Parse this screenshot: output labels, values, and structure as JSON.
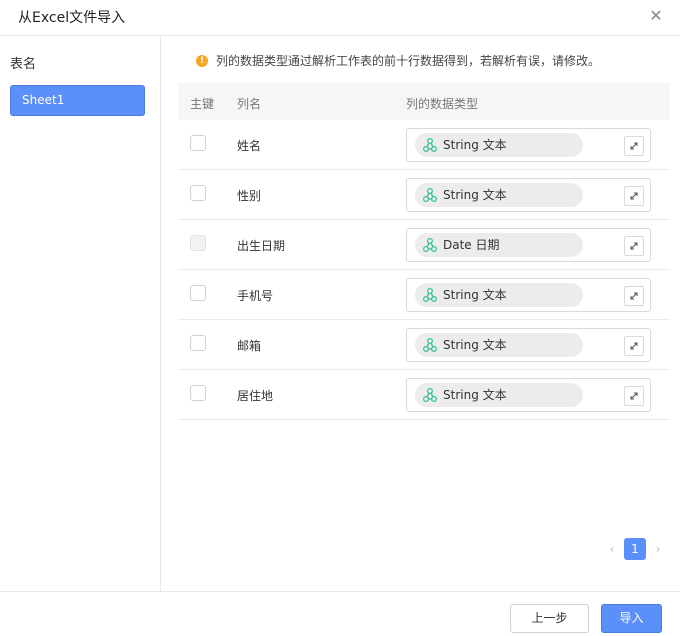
{
  "dialog": {
    "title": "从Excel文件导入",
    "close_icon": "close-icon"
  },
  "sidebar": {
    "label": "表名",
    "sheets": [
      {
        "label": "Sheet1",
        "selected": true
      }
    ]
  },
  "notice": {
    "icon": "warning-icon",
    "text": "列的数据类型通过解析工作表的前十行数据得到，若解析有误，请修改。"
  },
  "table": {
    "headers": {
      "key": "主键",
      "column": "列名",
      "type": "列的数据类型"
    },
    "rows": [
      {
        "name": "姓名",
        "type": "String 文本",
        "disabled": false
      },
      {
        "name": "性别",
        "type": "String 文本",
        "disabled": false
      },
      {
        "name": "出生日期",
        "type": "Date 日期",
        "disabled": true
      },
      {
        "name": "手机号",
        "type": "String 文本",
        "disabled": false
      },
      {
        "name": "邮箱",
        "type": "String 文本",
        "disabled": false
      },
      {
        "name": "居住地",
        "type": "String 文本",
        "disabled": false
      }
    ]
  },
  "pagination": {
    "prev": "‹",
    "current": "1",
    "next": "›"
  },
  "footer": {
    "prev_label": "上一步",
    "import_label": "导入"
  },
  "colors": {
    "accent": "#5b8ff9",
    "tag_icon": "#3cc28f",
    "warning": "#f5a623"
  }
}
